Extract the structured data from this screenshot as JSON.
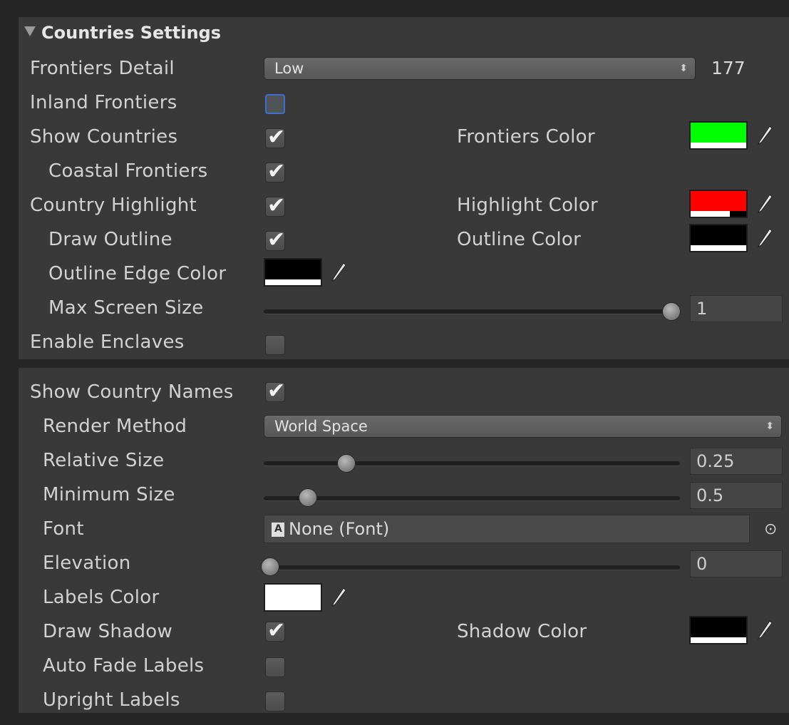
{
  "header": {
    "title": "Countries Settings"
  },
  "rows": {
    "frontiers_detail": {
      "label": "Frontiers Detail",
      "value": "Low",
      "count": "177"
    },
    "inland_frontiers": {
      "label": "Inland Frontiers",
      "checked": false
    },
    "show_countries": {
      "label": "Show Countries",
      "checked": true
    },
    "frontiers_color": {
      "label": "Frontiers Color",
      "color": "#00ff00",
      "alpha_fill": "100%"
    },
    "coastal_frontiers": {
      "label": "Coastal Frontiers",
      "checked": true
    },
    "country_highlight": {
      "label": "Country Highlight",
      "checked": true
    },
    "highlight_color": {
      "label": "Highlight Color",
      "color": "#ff0000",
      "alpha_fill": "70%"
    },
    "draw_outline": {
      "label": "Draw Outline",
      "checked": true
    },
    "outline_color": {
      "label": "Outline Color",
      "color": "#000000",
      "alpha_fill": "100%"
    },
    "outline_edge_color": {
      "label": "Outline Edge Color",
      "color": "#000000",
      "alpha_fill": "100%"
    },
    "max_screen_size": {
      "label": "Max Screen Size",
      "value": "1",
      "fraction": 1.0
    },
    "enable_enclaves": {
      "label": "Enable Enclaves",
      "checked": false
    },
    "show_country_names": {
      "label": "Show Country Names",
      "checked": true
    },
    "render_method": {
      "label": "Render Method",
      "value": "World Space"
    },
    "relative_size": {
      "label": "Relative Size",
      "value": "0.25",
      "fraction": 0.2
    },
    "minimum_size": {
      "label": "Minimum Size",
      "value": "0.5",
      "fraction": 0.1
    },
    "font": {
      "label": "Font",
      "value": "None (Font)"
    },
    "elevation": {
      "label": "Elevation",
      "value": "0",
      "fraction": 0.0
    },
    "labels_color": {
      "label": "Labels Color",
      "color": "#ffffff",
      "alpha_fill": "100%"
    },
    "draw_shadow": {
      "label": "Draw Shadow",
      "checked": true
    },
    "shadow_color": {
      "label": "Shadow Color",
      "color": "#000000",
      "alpha_fill": "100%"
    },
    "auto_fade_labels": {
      "label": "Auto Fade Labels",
      "checked": false
    },
    "upright_labels": {
      "label": "Upright Labels",
      "checked": false
    }
  },
  "icons": {
    "checkmark": "✔",
    "dropdown_arrows": "⬍",
    "object_picker": "⊙",
    "foldout": "▼"
  }
}
